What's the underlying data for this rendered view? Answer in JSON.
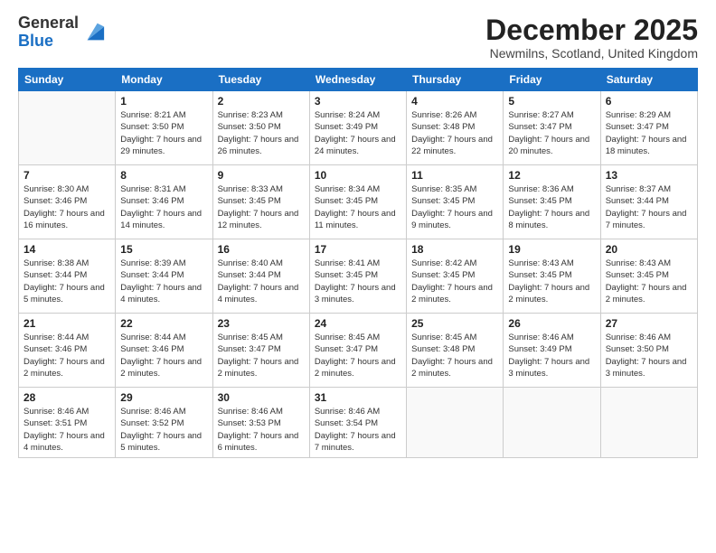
{
  "logo": {
    "general": "General",
    "blue": "Blue"
  },
  "header": {
    "month": "December 2025",
    "location": "Newmilns, Scotland, United Kingdom"
  },
  "weekdays": [
    "Sunday",
    "Monday",
    "Tuesday",
    "Wednesday",
    "Thursday",
    "Friday",
    "Saturday"
  ],
  "weeks": [
    [
      {
        "day": "",
        "info": ""
      },
      {
        "day": "1",
        "info": "Sunrise: 8:21 AM\nSunset: 3:50 PM\nDaylight: 7 hours\nand 29 minutes."
      },
      {
        "day": "2",
        "info": "Sunrise: 8:23 AM\nSunset: 3:50 PM\nDaylight: 7 hours\nand 26 minutes."
      },
      {
        "day": "3",
        "info": "Sunrise: 8:24 AM\nSunset: 3:49 PM\nDaylight: 7 hours\nand 24 minutes."
      },
      {
        "day": "4",
        "info": "Sunrise: 8:26 AM\nSunset: 3:48 PM\nDaylight: 7 hours\nand 22 minutes."
      },
      {
        "day": "5",
        "info": "Sunrise: 8:27 AM\nSunset: 3:47 PM\nDaylight: 7 hours\nand 20 minutes."
      },
      {
        "day": "6",
        "info": "Sunrise: 8:29 AM\nSunset: 3:47 PM\nDaylight: 7 hours\nand 18 minutes."
      }
    ],
    [
      {
        "day": "7",
        "info": "Sunrise: 8:30 AM\nSunset: 3:46 PM\nDaylight: 7 hours\nand 16 minutes."
      },
      {
        "day": "8",
        "info": "Sunrise: 8:31 AM\nSunset: 3:46 PM\nDaylight: 7 hours\nand 14 minutes."
      },
      {
        "day": "9",
        "info": "Sunrise: 8:33 AM\nSunset: 3:45 PM\nDaylight: 7 hours\nand 12 minutes."
      },
      {
        "day": "10",
        "info": "Sunrise: 8:34 AM\nSunset: 3:45 PM\nDaylight: 7 hours\nand 11 minutes."
      },
      {
        "day": "11",
        "info": "Sunrise: 8:35 AM\nSunset: 3:45 PM\nDaylight: 7 hours\nand 9 minutes."
      },
      {
        "day": "12",
        "info": "Sunrise: 8:36 AM\nSunset: 3:45 PM\nDaylight: 7 hours\nand 8 minutes."
      },
      {
        "day": "13",
        "info": "Sunrise: 8:37 AM\nSunset: 3:44 PM\nDaylight: 7 hours\nand 7 minutes."
      }
    ],
    [
      {
        "day": "14",
        "info": "Sunrise: 8:38 AM\nSunset: 3:44 PM\nDaylight: 7 hours\nand 5 minutes."
      },
      {
        "day": "15",
        "info": "Sunrise: 8:39 AM\nSunset: 3:44 PM\nDaylight: 7 hours\nand 4 minutes."
      },
      {
        "day": "16",
        "info": "Sunrise: 8:40 AM\nSunset: 3:44 PM\nDaylight: 7 hours\nand 4 minutes."
      },
      {
        "day": "17",
        "info": "Sunrise: 8:41 AM\nSunset: 3:45 PM\nDaylight: 7 hours\nand 3 minutes."
      },
      {
        "day": "18",
        "info": "Sunrise: 8:42 AM\nSunset: 3:45 PM\nDaylight: 7 hours\nand 2 minutes."
      },
      {
        "day": "19",
        "info": "Sunrise: 8:43 AM\nSunset: 3:45 PM\nDaylight: 7 hours\nand 2 minutes."
      },
      {
        "day": "20",
        "info": "Sunrise: 8:43 AM\nSunset: 3:45 PM\nDaylight: 7 hours\nand 2 minutes."
      }
    ],
    [
      {
        "day": "21",
        "info": "Sunrise: 8:44 AM\nSunset: 3:46 PM\nDaylight: 7 hours\nand 2 minutes."
      },
      {
        "day": "22",
        "info": "Sunrise: 8:44 AM\nSunset: 3:46 PM\nDaylight: 7 hours\nand 2 minutes."
      },
      {
        "day": "23",
        "info": "Sunrise: 8:45 AM\nSunset: 3:47 PM\nDaylight: 7 hours\nand 2 minutes."
      },
      {
        "day": "24",
        "info": "Sunrise: 8:45 AM\nSunset: 3:47 PM\nDaylight: 7 hours\nand 2 minutes."
      },
      {
        "day": "25",
        "info": "Sunrise: 8:45 AM\nSunset: 3:48 PM\nDaylight: 7 hours\nand 2 minutes."
      },
      {
        "day": "26",
        "info": "Sunrise: 8:46 AM\nSunset: 3:49 PM\nDaylight: 7 hours\nand 3 minutes."
      },
      {
        "day": "27",
        "info": "Sunrise: 8:46 AM\nSunset: 3:50 PM\nDaylight: 7 hours\nand 3 minutes."
      }
    ],
    [
      {
        "day": "28",
        "info": "Sunrise: 8:46 AM\nSunset: 3:51 PM\nDaylight: 7 hours\nand 4 minutes."
      },
      {
        "day": "29",
        "info": "Sunrise: 8:46 AM\nSunset: 3:52 PM\nDaylight: 7 hours\nand 5 minutes."
      },
      {
        "day": "30",
        "info": "Sunrise: 8:46 AM\nSunset: 3:53 PM\nDaylight: 7 hours\nand 6 minutes."
      },
      {
        "day": "31",
        "info": "Sunrise: 8:46 AM\nSunset: 3:54 PM\nDaylight: 7 hours\nand 7 minutes."
      },
      {
        "day": "",
        "info": ""
      },
      {
        "day": "",
        "info": ""
      },
      {
        "day": "",
        "info": ""
      }
    ]
  ]
}
